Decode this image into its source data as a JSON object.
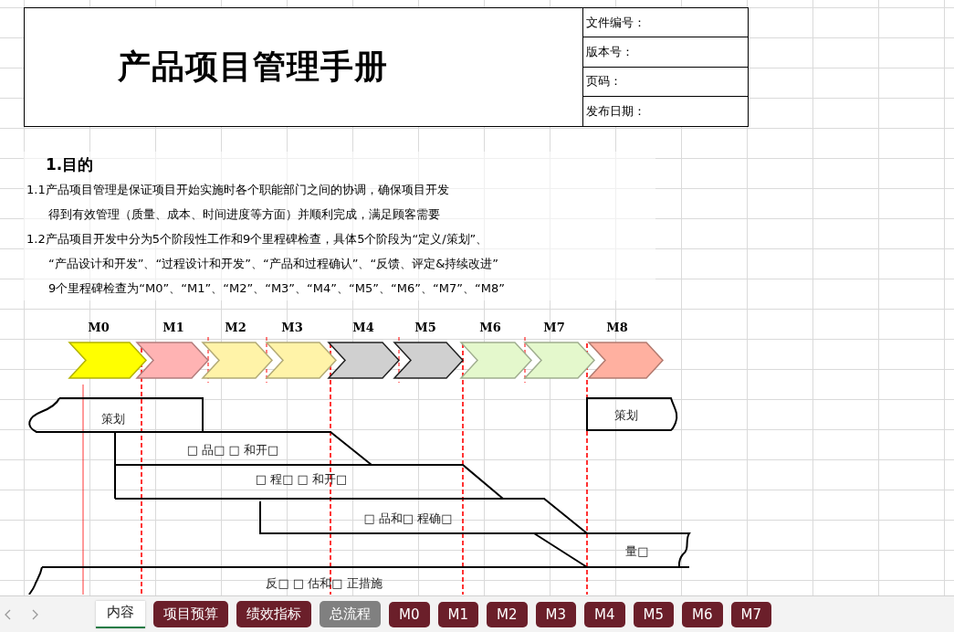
{
  "header": {
    "title": "产品项目管理手册",
    "fields": [
      "文件编号：",
      "版本号：",
      "页码：",
      "发布日期："
    ]
  },
  "section": {
    "heading": "1.目的",
    "lines": [
      {
        "text": "1.1产品项目管理是保证项目开始实施时各个职能部门之间的协调，确保项目开发",
        "indent": false
      },
      {
        "text": "得到有效管理（质量、成本、时间进度等方面）并顺利完成，满足顾客需要",
        "indent": true
      },
      {
        "text": "1.2产品项目开发中分为5个阶段性工作和9个里程碑检查，具体5个阶段为“定义/策划”、",
        "indent": false
      },
      {
        "text": "“产品设计和开发”、“过程设计和开发”、“产品和过程确认”、“反馈、评定&持续改进”",
        "indent": true
      },
      {
        "text": "9个里程碑检查为“M0”、“M1”、“M2”、“M3”、“M4”、“M5”、“M6”、“M7”、“M8”",
        "indent": true
      }
    ]
  },
  "milestones": [
    {
      "label": "M0",
      "color": "#ffff00"
    },
    {
      "label": "M1",
      "color": "#ffb3b3"
    },
    {
      "label": "M2",
      "color": "#fff3a8"
    },
    {
      "label": "M3",
      "color": "#fff3a8"
    },
    {
      "label": "M4",
      "color": "#d0d0d0"
    },
    {
      "label": "M5",
      "color": "#d0d0d0"
    },
    {
      "label": "M6",
      "color": "#e4f8cc"
    },
    {
      "label": "M7",
      "color": "#e4f8cc"
    },
    {
      "label": "M8",
      "color": "#ffb0a0"
    }
  ],
  "phases": [
    "策划",
    "□ 品□ □ 和开□",
    "□ 程□ □ 和开□",
    "□ 品和□ 程确□",
    "量□",
    "反□ □ 估和□ 正措施",
    "策划"
  ],
  "sheet_tabs": [
    {
      "label": "内容",
      "selected": true,
      "color": "#ffffff"
    },
    {
      "label": "项目预算",
      "selected": false,
      "color": "#6b1f2a"
    },
    {
      "label": "绩效指标",
      "selected": false,
      "color": "#6b1f2a"
    },
    {
      "label": "总流程",
      "selected": false,
      "color": "#808080"
    },
    {
      "label": "M0",
      "selected": false,
      "color": "#6b1f2a"
    },
    {
      "label": "M1",
      "selected": false,
      "color": "#6b1f2a"
    },
    {
      "label": "M2",
      "selected": false,
      "color": "#6b1f2a"
    },
    {
      "label": "M3",
      "selected": false,
      "color": "#6b1f2a"
    },
    {
      "label": "M4",
      "selected": false,
      "color": "#6b1f2a"
    },
    {
      "label": "M5",
      "selected": false,
      "color": "#6b1f2a"
    },
    {
      "label": "M6",
      "selected": false,
      "color": "#6b1f2a"
    },
    {
      "label": "M7",
      "selected": false,
      "color": "#6b1f2a"
    }
  ]
}
